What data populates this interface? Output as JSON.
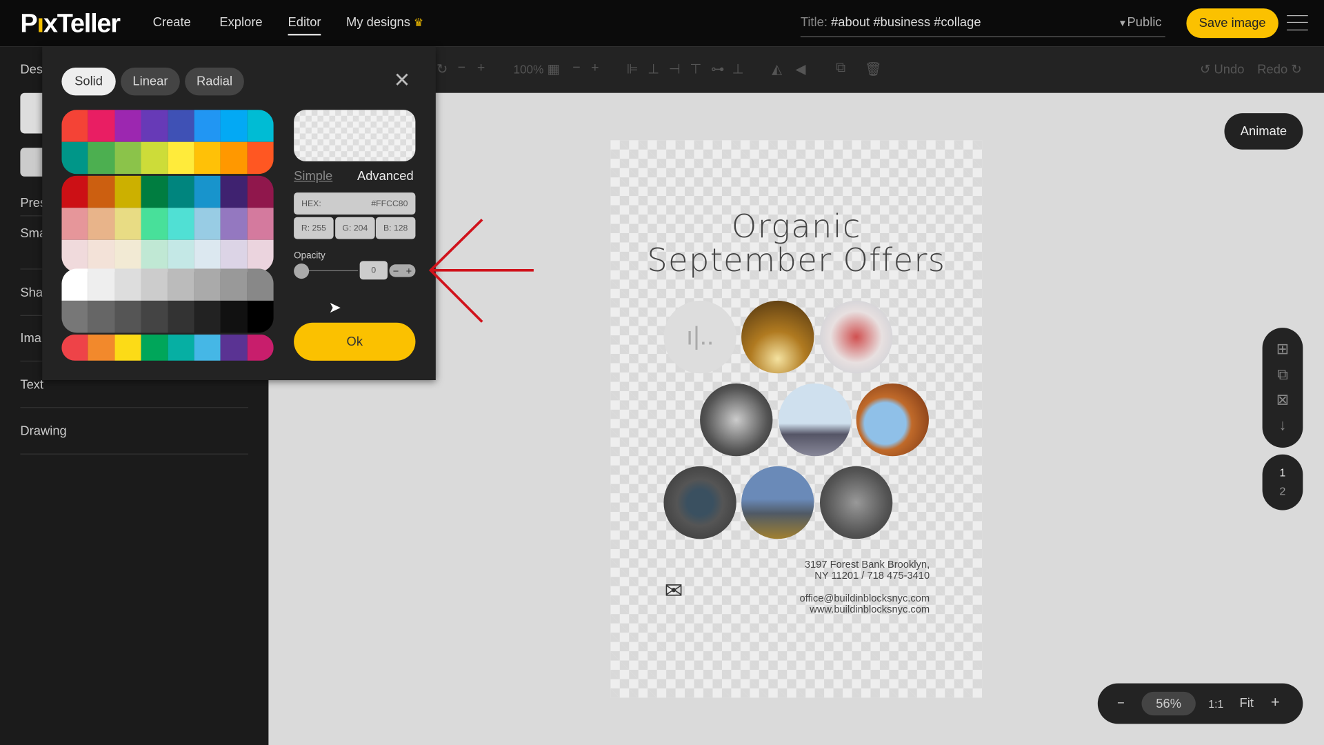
{
  "header": {
    "logo": "PixTeller",
    "nav": [
      "Create",
      "Explore",
      "Editor",
      "My designs"
    ],
    "active_nav": "Editor",
    "title_label": "Title:",
    "title_value": "#about #business #collage",
    "visibility": "Public",
    "save_label": "Save image"
  },
  "toolbar": {
    "zoom": "100%",
    "undo": "Undo",
    "redo": "Redo"
  },
  "sidebar": {
    "items": [
      "Des",
      "Pres",
      "Sma",
      "Sha",
      "Ima",
      "Text",
      "Drawing"
    ]
  },
  "design": {
    "line1": "Organic",
    "line2": "September Offers",
    "address1": "3197 Forest Bank Brooklyn,",
    "address2": "NY 11201 / 718 475-3410",
    "email": "office@buildinblocksnyc.com",
    "website": "www.buildinblocksnyc.com"
  },
  "animate_label": "Animate",
  "pages": [
    "1",
    "2"
  ],
  "zoombar": {
    "minus": "−",
    "value": "56%",
    "one_to_one": "1:1",
    "fit": "Fit",
    "plus": "+"
  },
  "color_picker": {
    "tabs": [
      "Solid",
      "Linear",
      "Radial"
    ],
    "selected_tab": "Solid",
    "mode_simple": "Simple",
    "mode_advanced": "Advanced",
    "hex_label": "HEX:",
    "hex": "#FFCC80",
    "r": "R: 255",
    "g": "G: 204",
    "b": "B: 128",
    "opacity_label": "Opacity",
    "opacity": "0",
    "opacity_fraction": 0,
    "ok_label": "Ok",
    "palettes": [
      [
        "#F44336",
        "#E91E63",
        "#9C27B0",
        "#673AB7",
        "#3F51B5",
        "#2196F3",
        "#03A9F4",
        "#00BCD4",
        "#009688",
        "#4CAF50",
        "#8BC34A",
        "#CDDC39",
        "#FFEB3B",
        "#FFC107",
        "#FF9800",
        "#FF5722"
      ],
      [
        "#CC1015",
        "#CC5F10",
        "#CCB000",
        "#007D40",
        "#00857E",
        "#1894CC",
        "#3F2270",
        "#90174C",
        "#E6969A",
        "#E8B48A",
        "#E8DC84",
        "#48E09A",
        "#50E0D4",
        "#98CCE4",
        "#9478C0",
        "#D47A9E",
        "#F0DADC",
        "#F3E2D8",
        "#F2EAD4",
        "#C0E8D4",
        "#C4E8E6",
        "#DCE8F0",
        "#DCD4E6",
        "#EBD4DE"
      ],
      [
        "#FFFFFF",
        "#EEEEEE",
        "#DDDDDD",
        "#CCCCCC",
        "#BBBBBB",
        "#AAAAAA",
        "#999999",
        "#888888",
        "#777777",
        "#666666",
        "#555555",
        "#444444",
        "#333333",
        "#222222",
        "#111111",
        "#000000"
      ],
      [
        "#EE4348",
        "#F2892C",
        "#FCDB17",
        "#00A65A",
        "#06AFA3",
        "#45B7E6",
        "#5A3393",
        "#C81E6C"
      ]
    ]
  },
  "colors": {
    "accent": "#FBC100",
    "annotation_arrow": "#D0121B"
  }
}
